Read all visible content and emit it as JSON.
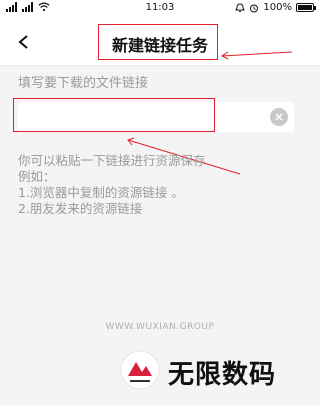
{
  "status_bar": {
    "time": "11:03",
    "battery": "100%",
    "battery_level": 1.0
  },
  "header": {
    "title": "新建链接任务",
    "back_icon": "chevron-left-icon"
  },
  "form": {
    "label": "填写要下载的文件链接",
    "input_value": "",
    "clear_icon": "close-icon"
  },
  "hint": {
    "lines": [
      "你可以粘贴一下链接进行资源保存",
      "例如：",
      "1.浏览器中复制的资源链接 。",
      "2.朋友发来的资源链接"
    ]
  },
  "watermark": {
    "url": "WWW.WUXIAN.GROUP",
    "brand": "无限数码"
  },
  "colors": {
    "annotation_red": "#e0202a",
    "background": "#f4f4f4",
    "muted_text": "#9a9a9a"
  }
}
